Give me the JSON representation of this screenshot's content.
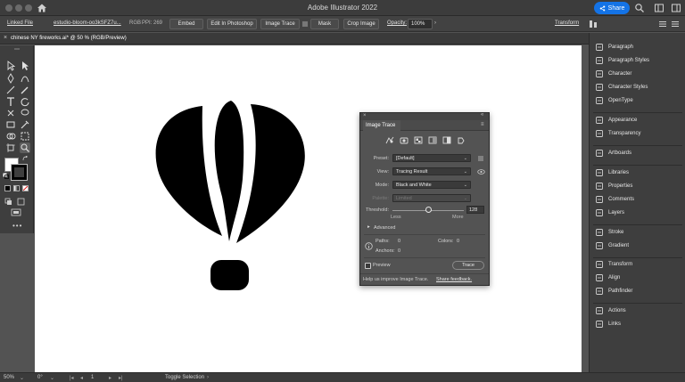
{
  "app": {
    "title": "Adobe Illustrator 2022",
    "share_label": "Share"
  },
  "control_bar": {
    "linked_file": "Linked File",
    "filename": "estudio-bloom-oo3kSFZ7u...",
    "color_mode": "RGB",
    "ppi": "PPI: 269",
    "embed": "Embed",
    "edit_in_photoshop": "Edit In Photoshop",
    "image_trace": "Image Trace",
    "mask": "Mask",
    "crop_image": "Crop Image",
    "opacity_label": "Opacity:",
    "opacity_value": "100%",
    "transform": "Transform"
  },
  "document_tab": {
    "close": "×",
    "label": "chinese NY fireworks.ai* @ 50 % (RGB/Preview)"
  },
  "right_panel": {
    "items": [
      {
        "label": "Paragraph",
        "icon": "paragraph-icon"
      },
      {
        "label": "Paragraph Styles",
        "icon": "paragraph-styles-icon"
      },
      {
        "label": "Character",
        "icon": "character-icon"
      },
      {
        "label": "Character Styles",
        "icon": "character-styles-icon"
      },
      {
        "label": "OpenType",
        "icon": "opentype-icon"
      },
      {
        "label": "Appearance",
        "icon": "appearance-icon"
      },
      {
        "label": "Transparency",
        "icon": "transparency-icon"
      },
      {
        "label": "Artboards",
        "icon": "artboards-icon"
      },
      {
        "label": "Libraries",
        "icon": "libraries-icon"
      },
      {
        "label": "Properties",
        "icon": "properties-icon"
      },
      {
        "label": "Comments",
        "icon": "comments-icon"
      },
      {
        "label": "Layers",
        "icon": "layers-icon"
      },
      {
        "label": "Stroke",
        "icon": "stroke-icon"
      },
      {
        "label": "Gradient",
        "icon": "gradient-icon"
      },
      {
        "label": "Transform",
        "icon": "transform-icon"
      },
      {
        "label": "Align",
        "icon": "align-icon"
      },
      {
        "label": "Pathfinder",
        "icon": "pathfinder-icon"
      },
      {
        "label": "Actions",
        "icon": "actions-icon"
      },
      {
        "label": "Links",
        "icon": "links-icon"
      }
    ]
  },
  "image_trace_panel": {
    "tab": "Image Trace",
    "preset_label": "Preset:",
    "preset_value": "[Default]",
    "view_label": "View:",
    "view_value": "Tracing Result",
    "mode_label": "Mode:",
    "mode_value": "Black and White",
    "palette_label": "Palette:",
    "palette_value": "Limited",
    "threshold_label": "Threshold:",
    "threshold_value": "128",
    "threshold_level": 0.5,
    "less": "Less",
    "more": "More",
    "advanced": "Advanced",
    "paths_label": "Paths:",
    "paths_value": "0",
    "anchors_label": "Anchors:",
    "anchors_value": "0",
    "colors_label": "Colors:",
    "colors_value": "0",
    "preview_label": "Preview",
    "trace_button": "Trace",
    "help_text": "Help us improve Image Trace.",
    "share_feedback": "Share feedback."
  },
  "status_bar": {
    "zoom": "50%",
    "rotation": "0°",
    "artboard_number": "1",
    "tool_hint": "Toggle Selection"
  }
}
